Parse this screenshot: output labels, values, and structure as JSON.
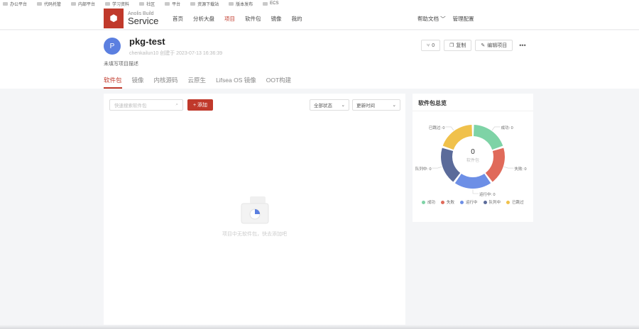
{
  "bookmarks": [
    "办公平台",
    "代码托管",
    "内部平台",
    "学习资料",
    "社区",
    "平台",
    "资源下载站",
    "版本发布",
    "ECS"
  ],
  "logo": {
    "top": "Anolis Build",
    "main": "Service"
  },
  "nav": {
    "items": [
      "首页",
      "分析大盘",
      "项目",
      "软件包",
      "镜像",
      "我的"
    ],
    "active_index": 2
  },
  "header_right": {
    "help": "帮助文档",
    "manage": "管理配置"
  },
  "project": {
    "avatar": "P",
    "name": "pkg-test",
    "meta": "chenkailun10  创建于 2023-07-13 16:36:39",
    "desc": "未填写项目描述",
    "fork_count": "0",
    "copy_label": "复制",
    "edit_label": "编辑项目",
    "more": "•••"
  },
  "tabs": [
    "软件包",
    "镜像",
    "内核源码",
    "云原生",
    "Lifsea OS 镜像",
    "OOT构建"
  ],
  "toolbar": {
    "search_placeholder": "快速搜索软件包",
    "add_label": "+ 添加",
    "status_select": "全部状态",
    "sort_select": "更新时间"
  },
  "empty_text": "项目中无软件包，快去添加吧",
  "overview": {
    "title": "软件包总览",
    "center_value": "0",
    "center_label": "软件包"
  },
  "chart_data": {
    "type": "pie",
    "categories": [
      "成功",
      "失败",
      "运行中",
      "队列中",
      "已跳过"
    ],
    "values": [
      0,
      0,
      0,
      0,
      0
    ],
    "labels": [
      "成功: 0",
      "失败: 0",
      "运行中: 0",
      "队列中: 0",
      "已跳过: 0"
    ],
    "colors": [
      "#7ed3a6",
      "#e06a5a",
      "#6d8fe6",
      "#5b6b9a",
      "#f0c14b"
    ]
  }
}
